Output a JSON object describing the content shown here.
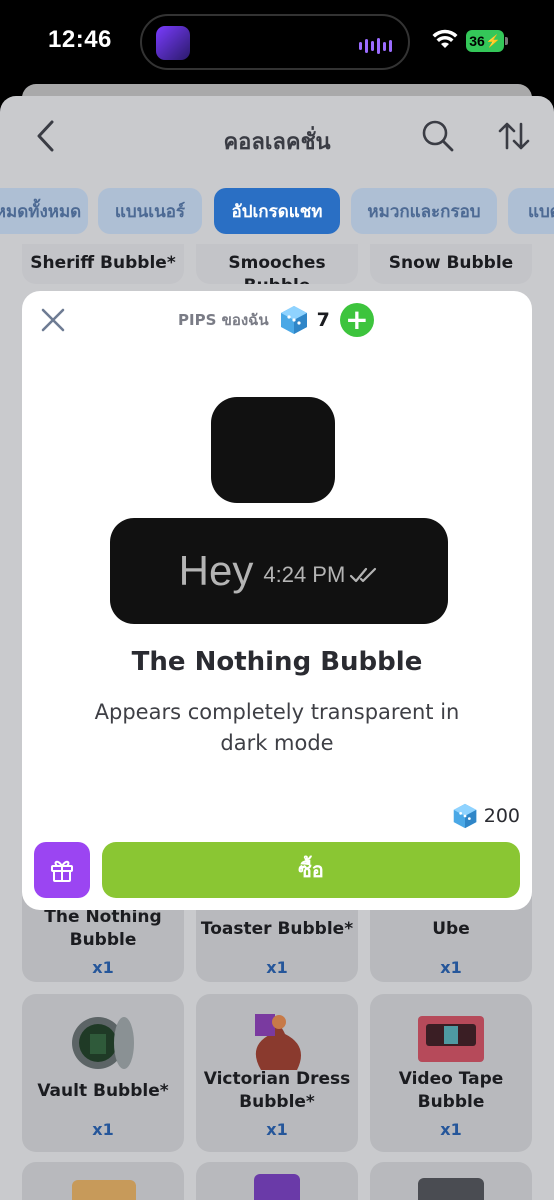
{
  "status": {
    "time": "12:46",
    "battery": "36"
  },
  "header": {
    "title": "คอลเลคชั่น"
  },
  "tabs": [
    {
      "label": "หมดทั้งหมด"
    },
    {
      "label": "แบนเนอร์"
    },
    {
      "label": "อัปเกรดแชท"
    },
    {
      "label": "หมวกและกรอบ"
    },
    {
      "label": "แบด"
    }
  ],
  "grid": {
    "top_row": [
      "Sheriff Bubble*",
      "Smooches Bubble",
      "Snow Bubble"
    ],
    "row2": [
      {
        "name": "The Nothing Bubble",
        "qty": "x1"
      },
      {
        "name": "Toaster Bubble*",
        "qty": "x1"
      },
      {
        "name": "Ube",
        "qty": "x1"
      }
    ],
    "row3": [
      {
        "name": "Vault Bubble*",
        "qty": "x1"
      },
      {
        "name": "Victorian Dress Bubble*",
        "qty": "x1"
      },
      {
        "name": "Video Tape Bubble",
        "qty": "x1"
      }
    ]
  },
  "modal": {
    "wallet_label": "PIPS ของฉัน",
    "wallet_count": "7",
    "preview_text": "Hey",
    "preview_time": "4:24 PM",
    "item_title": "The Nothing Bubble",
    "item_description": "Appears completely transparent in dark mode",
    "price": "200",
    "buy_label": "ซื้อ"
  },
  "colors": {
    "accent_tab": "#2a6fc4",
    "buy_button": "#8ac633",
    "gift_button": "#9b45f2",
    "plus_button": "#3dc43d"
  }
}
